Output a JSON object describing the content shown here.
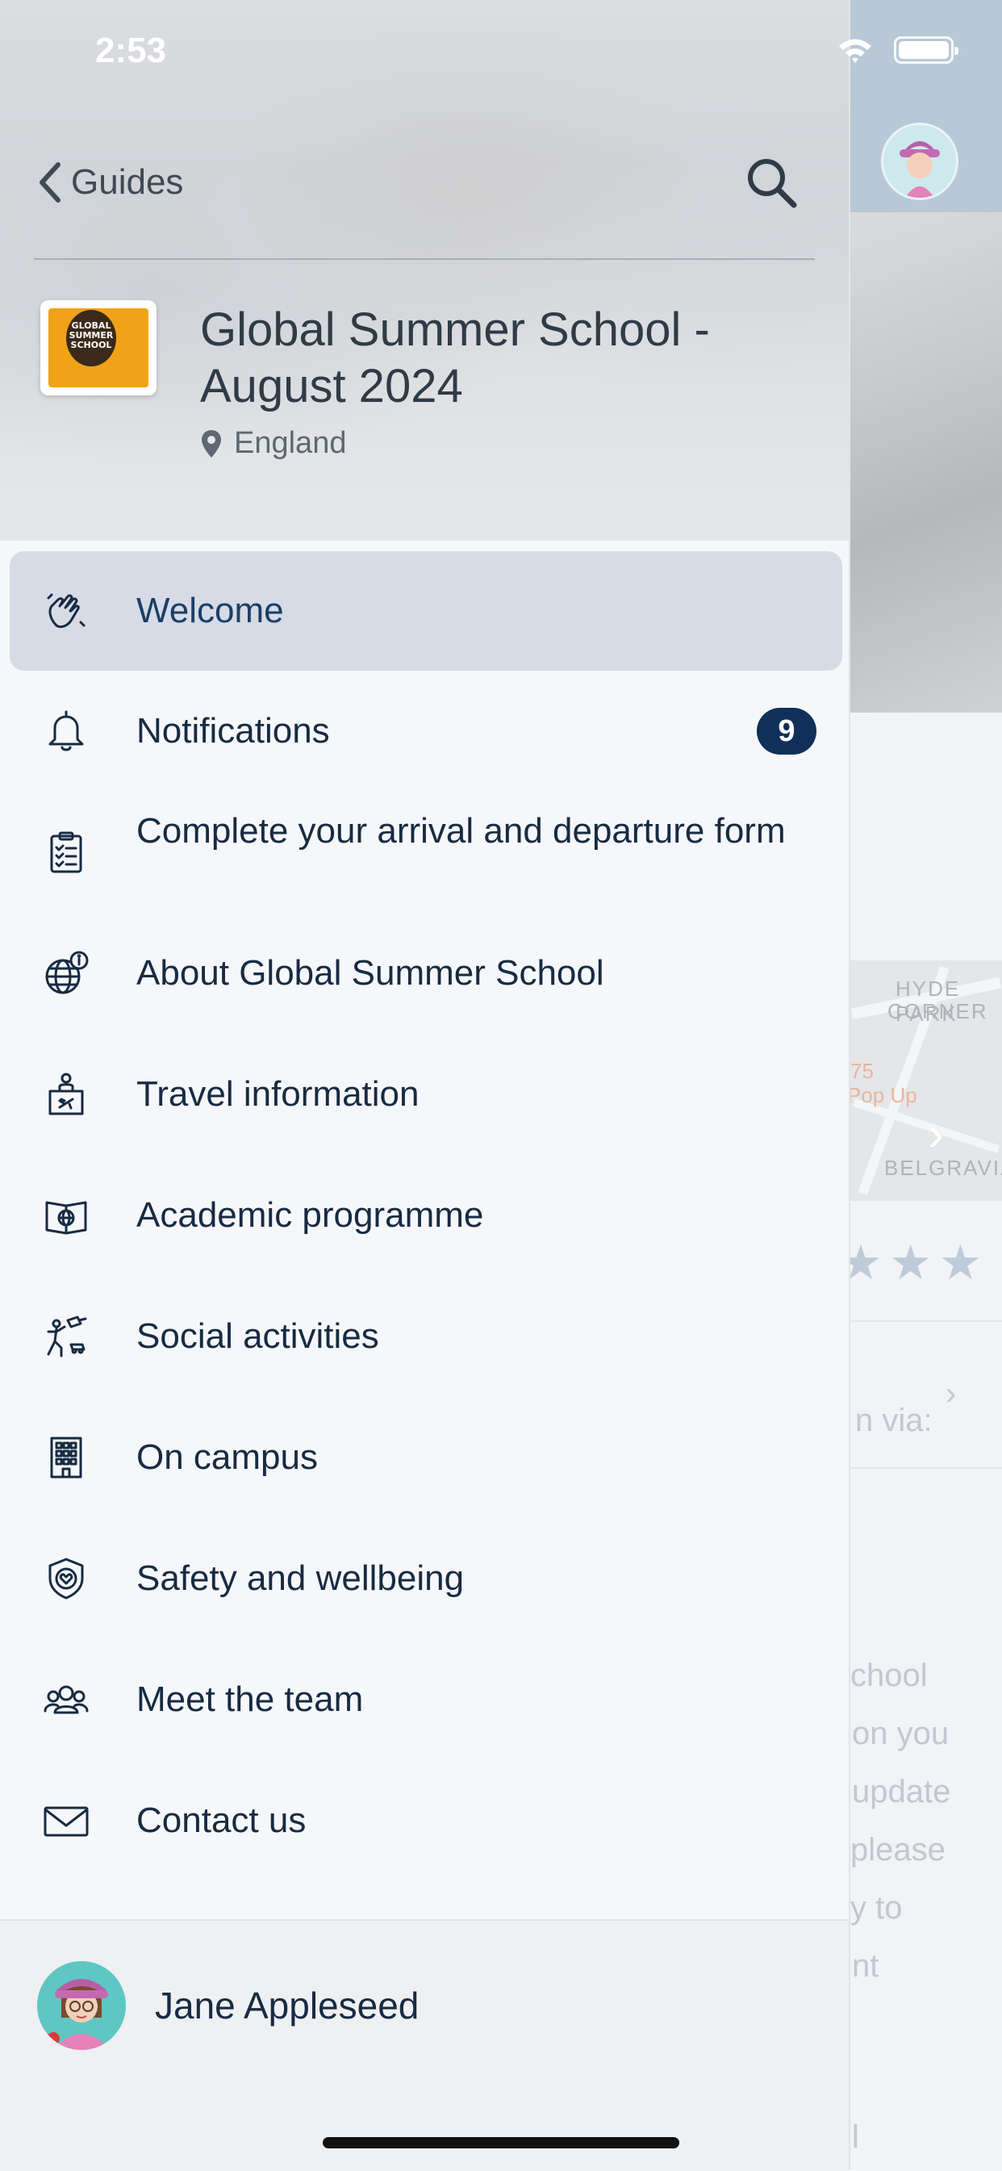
{
  "status_bar": {
    "time": "2:53"
  },
  "header": {
    "back_label": "Guides",
    "guide_title": "Global Summer School - August 2024",
    "location": "England",
    "logo_text": "GLOBAL SUMMER SCHOOL"
  },
  "menu": {
    "items": [
      {
        "label": "Welcome",
        "icon": "waving-hand-icon",
        "active": true
      },
      {
        "label": "Notifications",
        "icon": "bell-icon",
        "badge": "9"
      },
      {
        "label": "Complete your arrival and departure form",
        "icon": "clipboard-checklist-icon"
      },
      {
        "label": "About Global Summer School",
        "icon": "globe-info-icon"
      },
      {
        "label": "Travel information",
        "icon": "travel-desk-icon"
      },
      {
        "label": "Academic programme",
        "icon": "book-globe-icon"
      },
      {
        "label": "Social activities",
        "icon": "activities-icon"
      },
      {
        "label": "On campus",
        "icon": "building-icon"
      },
      {
        "label": "Safety and wellbeing",
        "icon": "shield-heart-icon"
      },
      {
        "label": "Meet the team",
        "icon": "team-icon"
      },
      {
        "label": "Contact us",
        "icon": "envelope-icon"
      }
    ]
  },
  "profile": {
    "name": "Jane Appleseed"
  },
  "background_page": {
    "map_labels": [
      "HYDE PARK",
      "CORNER",
      "BELGRAVIA",
      "75",
      "Pop Up"
    ],
    "text_fragments": [
      "n via:",
      "chool",
      "on you",
      "update",
      "please",
      "y to",
      "nt",
      "l"
    ]
  },
  "colors": {
    "drawer_background": "#f6f7fa",
    "active_item_background": "#d6dbe5",
    "text_primary": "#172b42",
    "badge_background": "#0f3059"
  }
}
